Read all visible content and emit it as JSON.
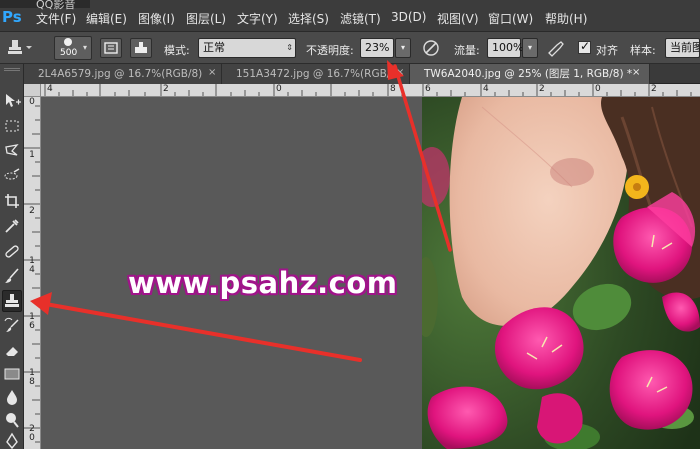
{
  "window": {
    "title": "QQ影音",
    "app_logo": "Ps"
  },
  "menu": {
    "items": [
      "文件(F)",
      "编辑(E)",
      "图像(I)",
      "图层(L)",
      "文字(Y)",
      "选择(S)",
      "滤镜(T)",
      "3D(D)",
      "视图(V)",
      "窗口(W)",
      "帮助(H)"
    ]
  },
  "options": {
    "brush_size": "500",
    "mode_label": "模式:",
    "mode_value": "正常",
    "opacity_label": "不透明度:",
    "opacity_value": "23%",
    "flow_label": "流量:",
    "flow_value": "100%",
    "aligned_label": "对齐",
    "aligned_checked": true,
    "sample_label": "样本:",
    "sample_value": "当前图"
  },
  "tabs": [
    {
      "label": "2L4A6579.jpg @ 16.7%(RGB/8)",
      "close": "×",
      "active": false
    },
    {
      "label": "151A3472.jpg @ 16.7%(RGB/8",
      "close": "×",
      "active": false
    },
    {
      "label": "TW6A2040.jpg @ 25% (图层 1, RGB/8) *",
      "close": "×",
      "active": true
    }
  ],
  "ruler_top": [
    "4",
    "2",
    "0",
    "8",
    "6",
    "4",
    "2",
    "0",
    "2"
  ],
  "ruler_left": [
    "0",
    "1",
    "2",
    "1",
    "4",
    "1",
    "6",
    "1",
    "8",
    "2",
    "0"
  ],
  "watermark": "www.psahz.com",
  "colors": {
    "accent_ps": "#31a8ff",
    "arrow_red": "#e8302a",
    "watermark_outline": "#a0148a",
    "flower_magenta": "#e0147e"
  },
  "tools": [
    "move-tool-icon",
    "marquee-tool-icon",
    "lasso-tool-icon",
    "quick-select-tool-icon",
    "crop-tool-icon",
    "eyedropper-tool-icon",
    "healing-brush-tool-icon",
    "brush-tool-icon",
    "clone-stamp-tool-icon",
    "history-brush-tool-icon",
    "eraser-tool-icon",
    "gradient-tool-icon",
    "blur-tool-icon",
    "dodge-tool-icon",
    "pen-tool-icon"
  ]
}
